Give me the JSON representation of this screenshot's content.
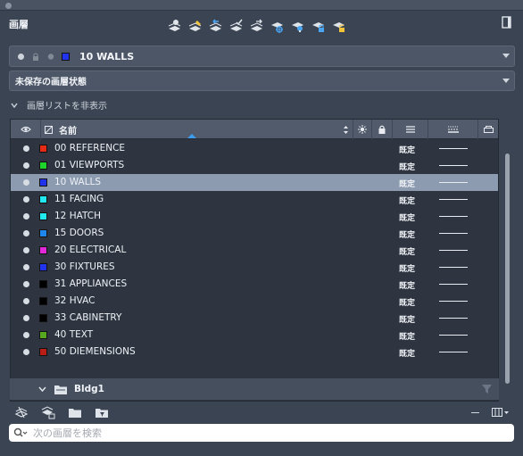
{
  "panel": {
    "title": "画層",
    "current_layer": {
      "name": "10 WALLS",
      "color": "#2233ee"
    },
    "layer_state": "未保存の画層状態",
    "hide_list_label": "画層リストを非表示"
  },
  "columns": {
    "visibility_icon": "eye-icon",
    "name_label": "名前",
    "freeze_icon": "sun-icon",
    "lock_icon": "lock-icon",
    "linetype_icon": "linetype-icon",
    "lineweight_icon": "lineweight-icon",
    "plot_icon": "plot-icon"
  },
  "layers": [
    {
      "name": "00 REFERENCE",
      "color": "#e32b16",
      "linetype": "既定",
      "selected": false
    },
    {
      "name": "01 VIEWPORTS",
      "color": "#1ed32a",
      "linetype": "既定",
      "selected": false
    },
    {
      "name": "10 WALLS",
      "color": "#2233ee",
      "linetype": "既定",
      "selected": true
    },
    {
      "name": "11 FACING",
      "color": "#22e8f0",
      "linetype": "既定",
      "selected": false
    },
    {
      "name": "12 HATCH",
      "color": "#22e8f0",
      "linetype": "既定",
      "selected": false
    },
    {
      "name": "15 DOORS",
      "color": "#1f86ee",
      "linetype": "既定",
      "selected": false
    },
    {
      "name": "20 ELECTRICAL",
      "color": "#e228d8",
      "linetype": "既定",
      "selected": false
    },
    {
      "name": "30 FIXTURES",
      "color": "#2233ee",
      "linetype": "既定",
      "selected": false
    },
    {
      "name": "31 APPLIANCES",
      "color": "#000000",
      "linetype": "既定",
      "selected": false
    },
    {
      "name": "32 HVAC",
      "color": "#000000",
      "linetype": "既定",
      "selected": false
    },
    {
      "name": "33 CABINETRY",
      "color": "#000000",
      "linetype": "既定",
      "selected": false
    },
    {
      "name": "40 TEXT",
      "color": "#55a81f",
      "linetype": "既定",
      "selected": false
    },
    {
      "name": "50 DIEMENSIONS",
      "color": "#b81d16",
      "linetype": "既定",
      "selected": false
    }
  ],
  "group": {
    "name": "Bldg1"
  },
  "search": {
    "placeholder": "次の画層を検索"
  },
  "colors": {
    "background": "#3b4453",
    "selection": "#8c9bb0",
    "accent": "#3b9cf0"
  }
}
